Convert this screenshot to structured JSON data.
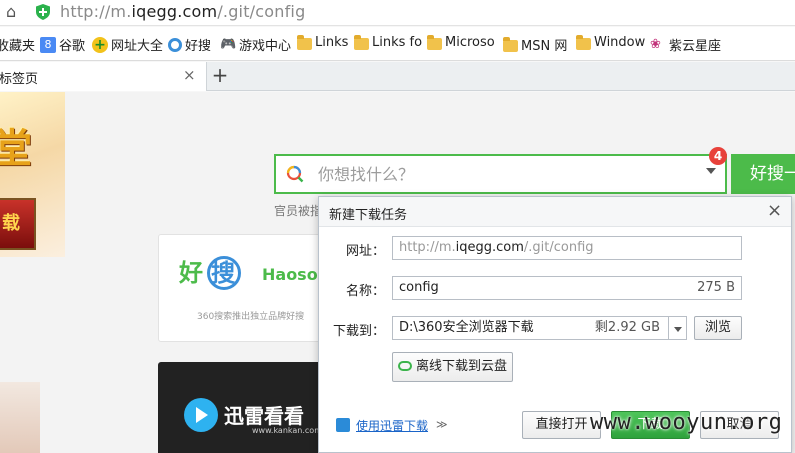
{
  "browser": {
    "url_prefix": "http://m.",
    "url_host": "iqegg.com",
    "url_path": "/.git/config",
    "bookmarks": [
      {
        "label": "收藏夹",
        "icon": "star-folder-icon"
      },
      {
        "label": "谷歌",
        "icon": "google-icon"
      },
      {
        "label": "网址大全",
        "icon": "nav-plus-icon"
      },
      {
        "label": "好搜",
        "icon": "haosou-icon"
      },
      {
        "label": "游戏中心",
        "icon": "gamepad-icon"
      },
      {
        "label": "Links",
        "icon": "folder-icon"
      },
      {
        "label": "Links fo",
        "icon": "folder-icon"
      },
      {
        "label": "Microso",
        "icon": "folder-icon"
      },
      {
        "label": "MSN 网",
        "icon": "folder-icon"
      },
      {
        "label": "Window",
        "icon": "folder-icon"
      },
      {
        "label": "紫云星座",
        "icon": "zodiac-icon"
      }
    ],
    "tab_title": "新标签页",
    "close_glyph": "×",
    "new_tab_glyph": "+"
  },
  "page": {
    "search_placeholder": "你想找什么？",
    "badge_count": "4",
    "search_button": "好搜一",
    "helper_text": "官员被指",
    "haosou_cn_1": "好",
    "haosou_cn_2": "搜",
    "haosou_en": "Haosou",
    "haosou_tagline": "360搜索推出独立品牌好搜",
    "kankan_name": "迅雷看看",
    "kankan_url": "www.kankan.com",
    "game_title": "堂",
    "game_button": "载"
  },
  "dialog": {
    "title": "新建下载任务",
    "close_glyph": "×",
    "url_label": "网址：",
    "url_prefix": "http://m.",
    "url_host": "iqegg.com",
    "url_path": "/.git/config",
    "name_label": "名称：",
    "name_value": "config",
    "size_value": "275 B",
    "save_label": "下载到：",
    "save_path": "D:\\360安全浏览器下载",
    "free_space": "剩2.92 GB",
    "browse_button": "浏览",
    "cloud_button": "离线下载到云盘",
    "xunlei_link": "使用迅雷下载",
    "expand_glyph": "≫",
    "open_button": "直接打开",
    "download_button": "下载",
    "cancel_button": "取消"
  },
  "watermark": "www.wooyun.org",
  "colors": {
    "accent_green": "#4cbb4a",
    "badge_red": "#e8413a",
    "link_blue": "#1a64c8"
  }
}
